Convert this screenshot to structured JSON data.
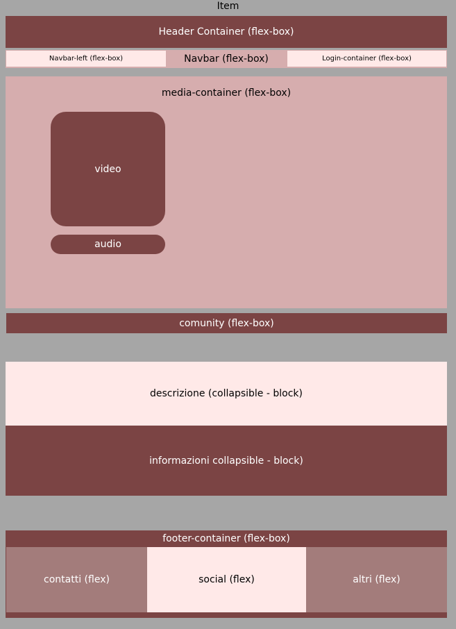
{
  "title": "Item",
  "header": {
    "label": "Header Container (flex-box)"
  },
  "navbar": {
    "label": "Navbar (flex-box)",
    "left_label": "Navbar-left (flex-box)",
    "login_label": "Login-container (flex-box)"
  },
  "media": {
    "label": "media-container (flex-box)",
    "video_label": "video",
    "audio_label": "audio"
  },
  "community": {
    "label": "comunity (flex-box)"
  },
  "collapsibles": {
    "descrizione_label": "descrizione (collapsible - block)",
    "informazioni_label": "informazioni collapsible - block)"
  },
  "footer": {
    "label": "footer-container (flex-box)",
    "contatti_label": "contatti (flex)",
    "social_label": "social (flex)",
    "altri_label": "altri (flex)"
  },
  "colors": {
    "background": "#a6a6a6",
    "dark_block": "#7b4444",
    "light_block": "#ffe9e8",
    "pink_block": "#d6adae",
    "muted_block": "#a37c7b"
  }
}
